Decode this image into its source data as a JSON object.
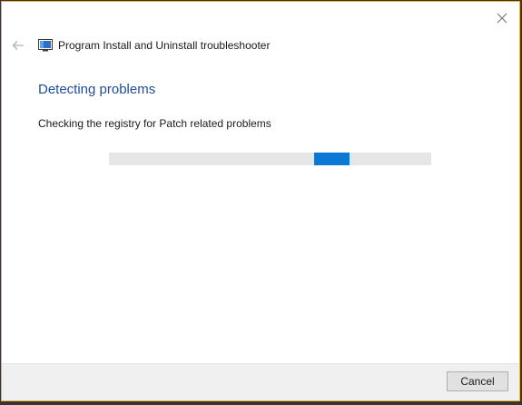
{
  "window": {
    "title": "Program Install and Uninstall troubleshooter",
    "border_color": "#e8b53c"
  },
  "icons": {
    "close": "close-icon",
    "back": "back-arrow-icon",
    "app": "troubleshooter-app-icon"
  },
  "main": {
    "heading": "Detecting problems",
    "heading_color": "#1e4fa1",
    "status_text": "Checking the registry for Patch related problems"
  },
  "progress": {
    "mode": "indeterminate",
    "chunk_start_fraction": 0.637,
    "chunk_end_fraction": 0.746,
    "accent_color": "#0a78d4"
  },
  "footer": {
    "cancel_label": "Cancel"
  }
}
